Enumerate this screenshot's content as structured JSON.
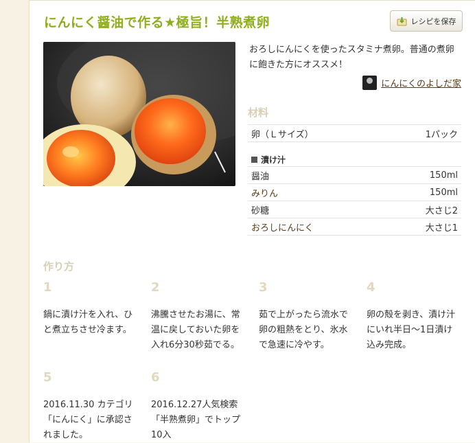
{
  "recipe": {
    "title": "にんにく醤油で作る★極旨！半熟煮卵",
    "save_label": "レシピを保存",
    "description": "おろしにんにくを使ったスタミナ煮卵。普通の煮卵に飽きた方にオススメ！",
    "author": "にんにくのよしだ家"
  },
  "ingredients": {
    "title": "材料",
    "main": [
      {
        "name": "卵（Ｌサイズ）",
        "amount": "1パック"
      }
    ],
    "group_title": "漬け汁",
    "group_items": [
      {
        "name": "醤油",
        "amount": "150ml"
      },
      {
        "name": "みりん",
        "amount": "150ml"
      },
      {
        "name": "砂糖",
        "amount": "大さじ2"
      },
      {
        "name": "おろしにんにく",
        "amount": "大さじ1"
      }
    ]
  },
  "steps": {
    "title": "作り方",
    "items": [
      {
        "num": "1",
        "text": "鍋に漬け汁を入れ、ひと煮立ちさせ冷ます。"
      },
      {
        "num": "2",
        "text": "沸騰させたお湯に、常温に戻しておいた卵を入れ6分30秒茹でる。"
      },
      {
        "num": "3",
        "text": "茹で上がったら流水で卵の粗熱をとり、氷水で急速に冷やす。"
      },
      {
        "num": "4",
        "text": "卵の殻を剥き、漬け汁にいれ半日〜1日漬け込み完成。"
      },
      {
        "num": "5",
        "text": "2016.11.30 カテゴリ「にんにく」に承認されました。"
      },
      {
        "num": "6",
        "text": "2016.12.27人気検索「半熟煮卵」でトップ10入"
      }
    ]
  },
  "colors": {
    "title": "#8fae1b",
    "section": "#d9cfb4",
    "step_number": "#e2d8bd",
    "link": "#5a3a1a"
  },
  "icons": {
    "save": "save-to-folder-icon",
    "author": "author-avatar-icon"
  }
}
